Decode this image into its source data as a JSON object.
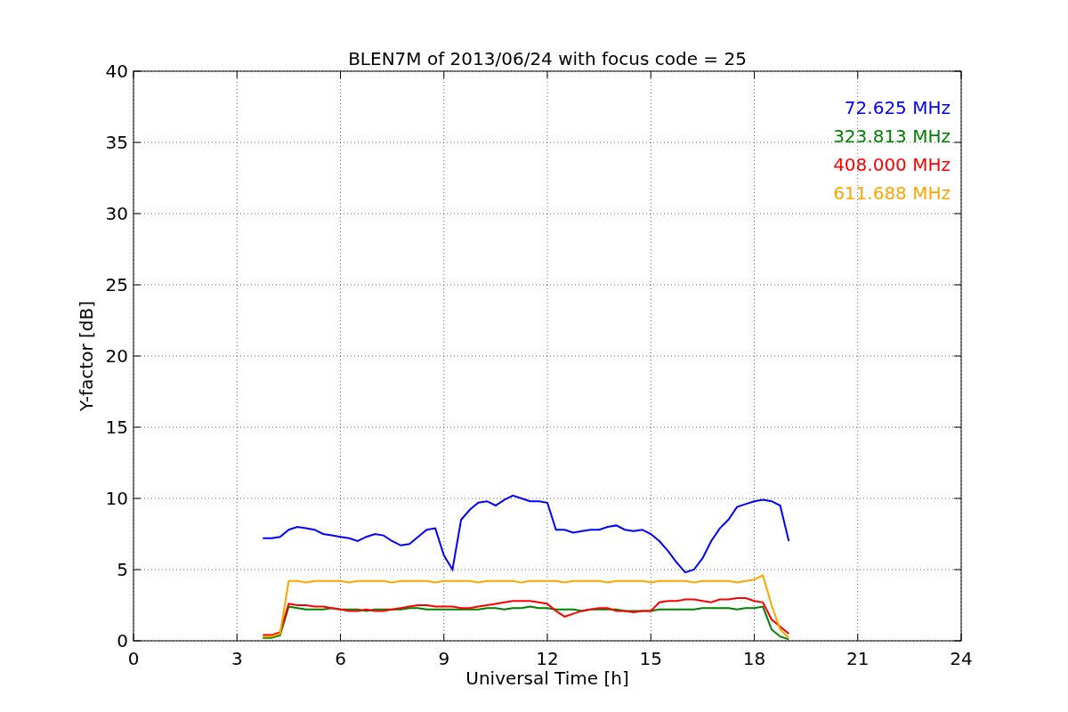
{
  "chart_data": {
    "type": "line",
    "title": "BLEN7M of 2013/06/24 with focus code = 25",
    "xlabel": "Universal Time [h]",
    "ylabel": "Y-factor [dB]",
    "x": [
      3.75,
      4.0,
      4.25,
      4.5,
      4.75,
      5.0,
      5.25,
      5.5,
      5.75,
      6.0,
      6.25,
      6.5,
      6.75,
      7.0,
      7.25,
      7.5,
      7.75,
      8.0,
      8.25,
      8.5,
      8.75,
      9.0,
      9.25,
      9.5,
      9.75,
      10.0,
      10.25,
      10.5,
      10.75,
      11.0,
      11.25,
      11.5,
      11.75,
      12.0,
      12.25,
      12.5,
      12.75,
      13.0,
      13.25,
      13.5,
      13.75,
      14.0,
      14.25,
      14.5,
      14.75,
      15.0,
      15.25,
      15.5,
      15.75,
      16.0,
      16.25,
      16.5,
      16.75,
      17.0,
      17.25,
      17.5,
      17.75,
      18.0,
      18.25,
      18.5,
      18.75,
      19.0
    ],
    "series": [
      {
        "name": "72.625 MHz",
        "color": "#0000ff",
        "values": [
          7.2,
          7.2,
          7.3,
          7.8,
          8.0,
          7.9,
          7.8,
          7.5,
          7.4,
          7.3,
          7.2,
          7.0,
          7.3,
          7.5,
          7.4,
          7.0,
          6.7,
          6.8,
          7.3,
          7.8,
          7.9,
          6.0,
          5.0,
          8.5,
          9.2,
          9.7,
          9.8,
          9.5,
          9.9,
          10.2,
          10.0,
          9.8,
          9.8,
          9.7,
          7.8,
          7.8,
          7.6,
          7.7,
          7.8,
          7.8,
          8.0,
          8.1,
          7.8,
          7.7,
          7.8,
          7.5,
          7.0,
          6.3,
          5.5,
          4.8,
          5.0,
          5.8,
          7.0,
          7.9,
          8.5,
          9.4,
          9.6,
          9.8,
          9.9,
          9.8,
          9.5,
          7.0
        ]
      },
      {
        "name": "323.813 MHz",
        "color": "#008000",
        "values": [
          0.2,
          0.2,
          0.4,
          2.4,
          2.3,
          2.2,
          2.2,
          2.2,
          2.3,
          2.2,
          2.2,
          2.2,
          2.1,
          2.2,
          2.2,
          2.2,
          2.2,
          2.3,
          2.3,
          2.2,
          2.2,
          2.2,
          2.2,
          2.2,
          2.2,
          2.2,
          2.3,
          2.3,
          2.2,
          2.3,
          2.3,
          2.4,
          2.3,
          2.3,
          2.2,
          2.2,
          2.2,
          2.1,
          2.2,
          2.2,
          2.2,
          2.2,
          2.1,
          2.1,
          2.1,
          2.1,
          2.2,
          2.2,
          2.2,
          2.2,
          2.2,
          2.3,
          2.3,
          2.3,
          2.3,
          2.2,
          2.3,
          2.3,
          2.4,
          0.8,
          0.3,
          0.1
        ]
      },
      {
        "name": "408.000 MHz",
        "color": "#ff0000",
        "values": [
          0.4,
          0.4,
          0.6,
          2.6,
          2.5,
          2.5,
          2.4,
          2.4,
          2.3,
          2.2,
          2.1,
          2.1,
          2.2,
          2.1,
          2.1,
          2.2,
          2.3,
          2.4,
          2.5,
          2.5,
          2.4,
          2.4,
          2.4,
          2.3,
          2.3,
          2.4,
          2.5,
          2.6,
          2.7,
          2.8,
          2.8,
          2.8,
          2.7,
          2.6,
          2.1,
          1.7,
          1.9,
          2.1,
          2.2,
          2.3,
          2.3,
          2.1,
          2.1,
          2.0,
          2.1,
          2.1,
          2.7,
          2.8,
          2.8,
          2.9,
          2.9,
          2.8,
          2.7,
          2.9,
          2.9,
          3.0,
          3.0,
          2.8,
          2.7,
          1.5,
          1.0,
          0.5
        ]
      },
      {
        "name": "611.688 MHz",
        "color": "#ffa500",
        "values": [
          0.3,
          0.3,
          0.5,
          4.2,
          4.2,
          4.1,
          4.2,
          4.2,
          4.2,
          4.2,
          4.1,
          4.2,
          4.2,
          4.2,
          4.2,
          4.1,
          4.2,
          4.2,
          4.2,
          4.2,
          4.1,
          4.2,
          4.2,
          4.2,
          4.2,
          4.1,
          4.2,
          4.2,
          4.2,
          4.2,
          4.1,
          4.2,
          4.2,
          4.2,
          4.2,
          4.1,
          4.2,
          4.2,
          4.2,
          4.2,
          4.1,
          4.2,
          4.2,
          4.2,
          4.2,
          4.1,
          4.2,
          4.2,
          4.2,
          4.2,
          4.1,
          4.2,
          4.2,
          4.2,
          4.2,
          4.1,
          4.2,
          4.3,
          4.6,
          2.5,
          0.8,
          0.2
        ]
      }
    ],
    "grid": true,
    "xlim": [
      0,
      24
    ],
    "ylim": [
      0,
      40
    ],
    "xticks": [
      0,
      3,
      6,
      9,
      12,
      15,
      18,
      21,
      24
    ],
    "yticks": [
      0,
      5,
      10,
      15,
      20,
      25,
      30,
      35,
      40
    ]
  }
}
